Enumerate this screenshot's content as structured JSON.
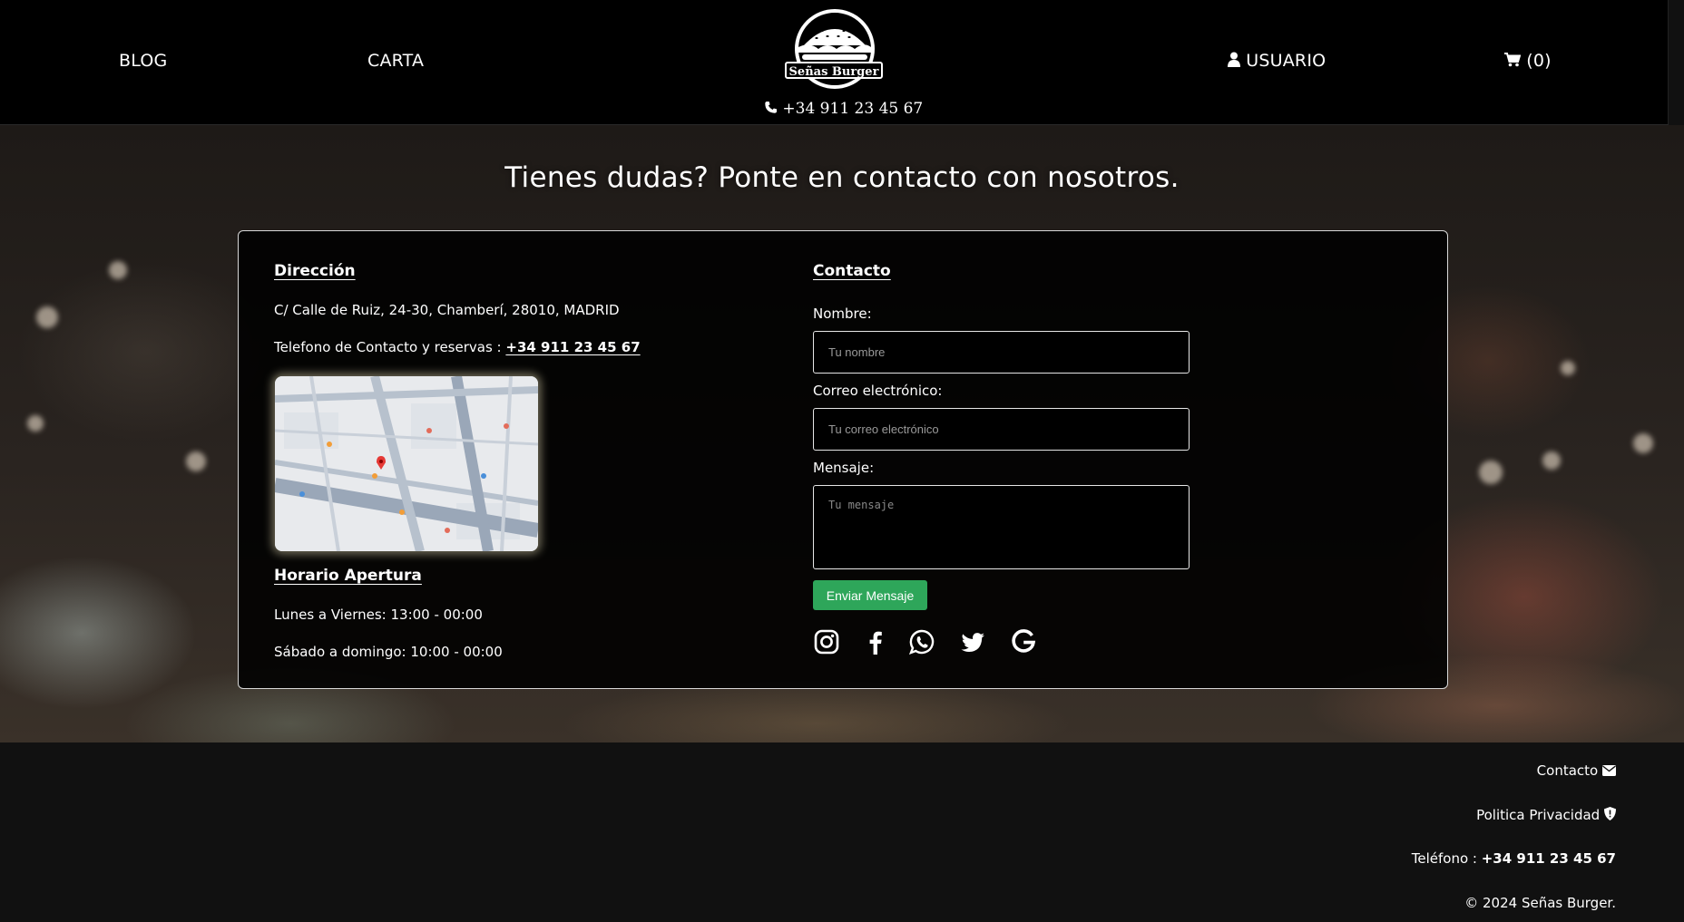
{
  "nav": {
    "blog": "BLOG",
    "carta": "CARTA",
    "usuario": "USUARIO",
    "cart_count": "(0)"
  },
  "brand": {
    "name": "Señas Burger",
    "phone": "+34 911 23 45 67"
  },
  "hero": {
    "title": "Tienes dudas? Ponte en contacto con nosotros."
  },
  "address": {
    "title": "Dirección",
    "line": "C/ Calle de Ruiz, 24-30, Chamberí, 28010, MADRID",
    "phone_label": "Telefono de Contacto y reservas :",
    "phone_value": "+34 911 23 45 67"
  },
  "hours": {
    "title": "Horario Apertura",
    "weekdays": "Lunes a Viernes: 13:00 - 00:00",
    "weekend": "Sábado a domingo: 10:00 - 00:00"
  },
  "contact_form": {
    "title": "Contacto",
    "name_label": "Nombre:",
    "name_placeholder": "Tu nombre",
    "email_label": "Correo electrónico:",
    "email_placeholder": "Tu correo electrónico",
    "message_label": "Mensaje:",
    "message_placeholder": "Tu mensaje",
    "submit": "Enviar Mensaje"
  },
  "social": [
    "instagram-icon",
    "facebook-icon",
    "whatsapp-icon",
    "twitter-icon",
    "google-icon"
  ],
  "footer": {
    "contacto": "Contacto",
    "privacidad": "Politica Privacidad",
    "telefono_label": "Teléfono :",
    "telefono_value": "+34 911 23 45 67",
    "copyright": "© 2024 Señas Burger."
  },
  "colors": {
    "accent": "#2ea65a",
    "background": "#000000",
    "footer": "#111111"
  }
}
